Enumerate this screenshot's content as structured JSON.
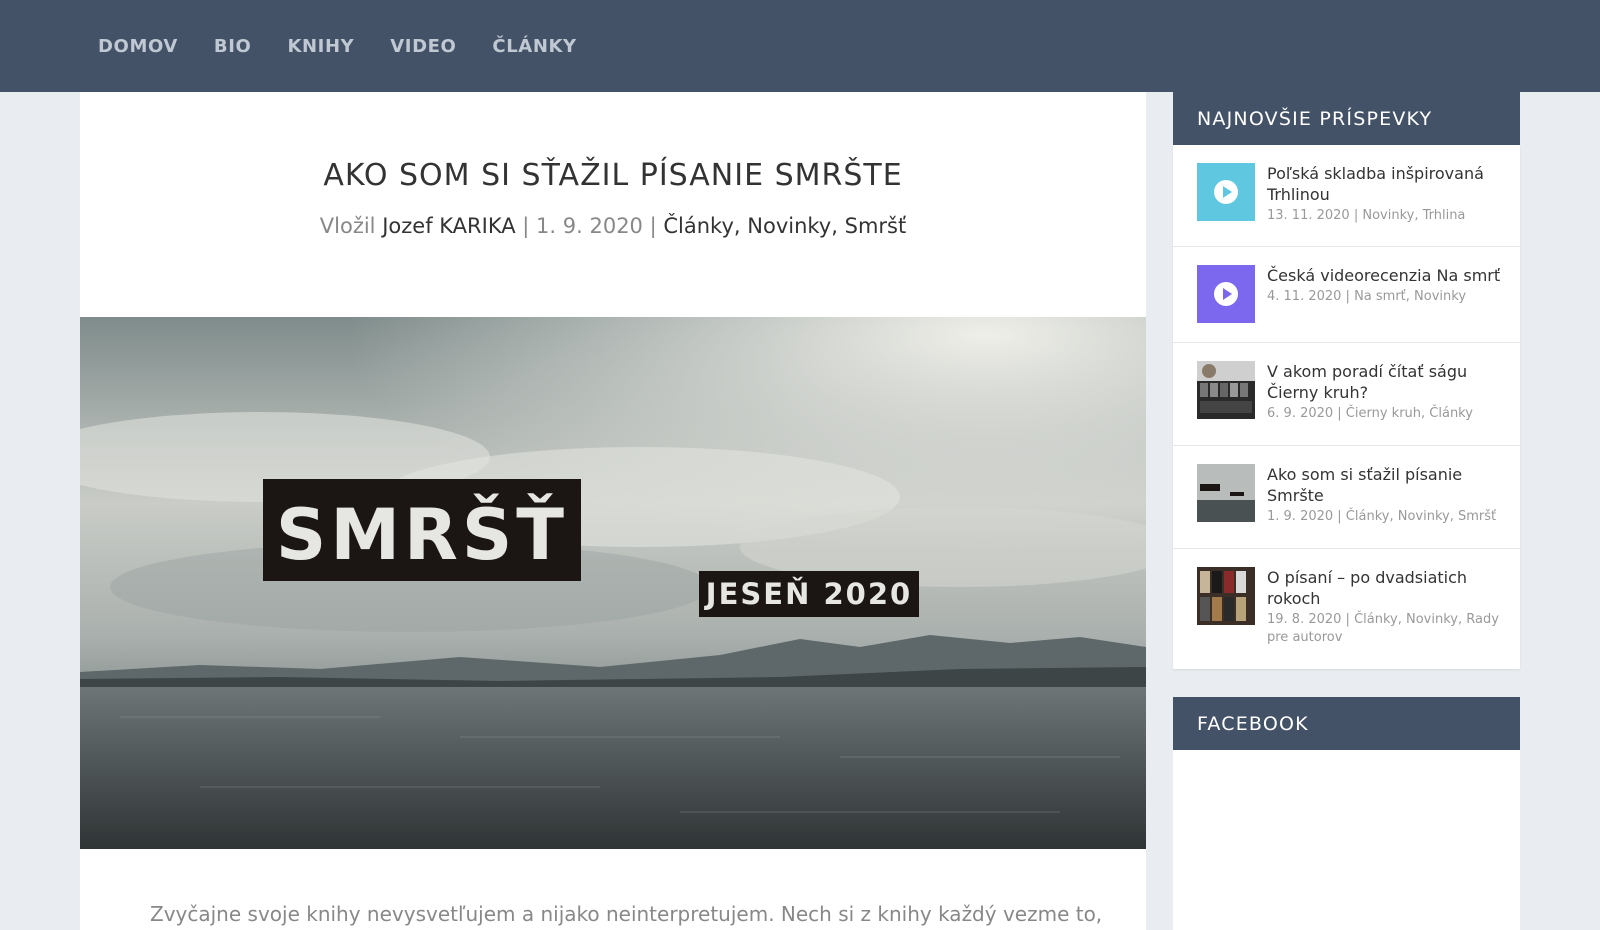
{
  "nav": {
    "items": [
      "DOMOV",
      "BIO",
      "KNIHY",
      "VIDEO",
      "ČLÁNKY"
    ]
  },
  "article": {
    "title": "AKO SOM SI SŤAŽIL PÍSANIE SMRŠTE",
    "meta": {
      "by_label": "Vložil",
      "author": "Jozef KARIKA",
      "date": "1. 9. 2020",
      "categories": [
        "Články",
        "Novinky",
        "Smršť"
      ]
    },
    "hero": {
      "word": "SMRŠŤ",
      "subtitle": "JESEŇ 2020"
    },
    "intro": "Zvyčajne svoje knihy nevysvetľujem a nijako neinterpretujem. Nech si z knihy každý vezme to,"
  },
  "sidebar": {
    "recent_title": "NAJNOVŠIE PRÍSPEVKY",
    "posts": [
      {
        "title": "Poľská skladba inšpirovaná Trhlinou",
        "meta": "13. 11. 2020 | Novinky, Trhlina",
        "thumb_icon": "play-icon",
        "thumb_color": "#5fc8e0"
      },
      {
        "title": "Česká videorecenzia Na smrť",
        "meta": "4. 11. 2020 | Na smrť, Novinky",
        "thumb_icon": "play-icon",
        "thumb_color": "#7b68ee"
      },
      {
        "title": "V akom poradí čítať ságu Čierny kruh?",
        "meta": "6. 9. 2020 | Čierny kruh, Články",
        "thumb_icon": "books-photo",
        "thumb_color": "#555555"
      },
      {
        "title": "Ako som si sťažil písanie Smršte",
        "meta": "1. 9. 2020 | Články, Novinky, Smršť",
        "thumb_icon": "lake-photo",
        "thumb_color": "#6f7c80"
      },
      {
        "title": "O písaní – po dvadsiatich rokoch",
        "meta": "19. 8. 2020 | Články, Novinky, Rady pre autorov",
        "thumb_icon": "books-photo",
        "thumb_color": "#7a5a3a"
      }
    ],
    "facebook_title": "FACEBOOK"
  }
}
